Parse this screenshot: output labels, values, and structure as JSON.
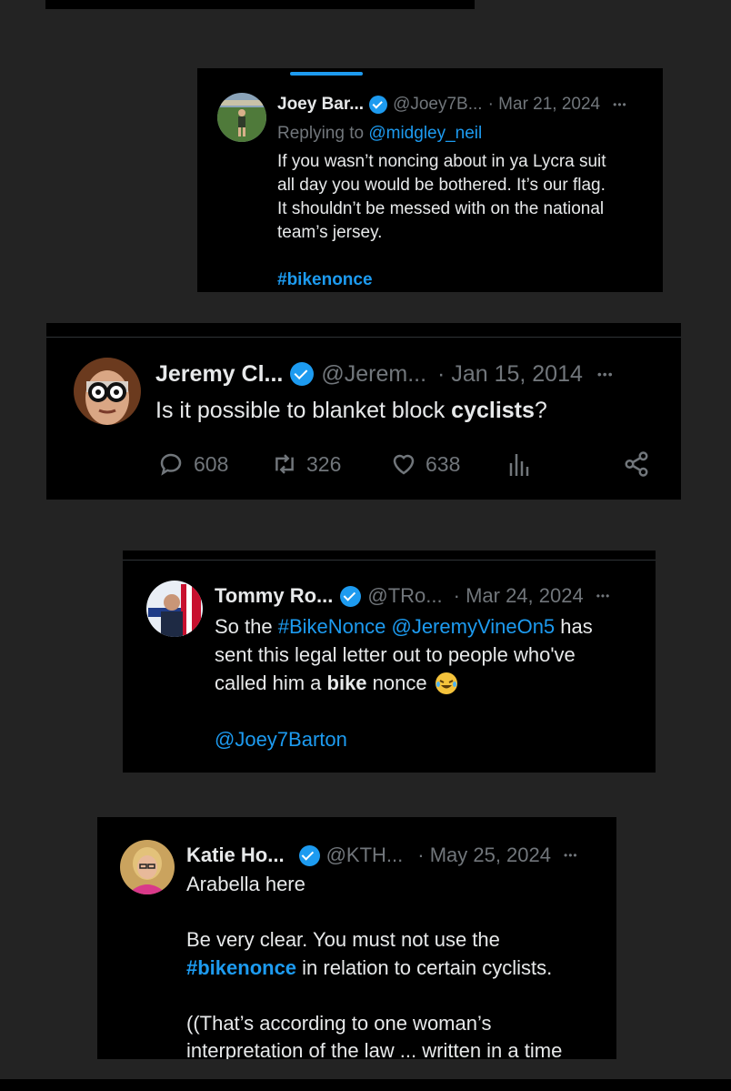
{
  "tweet1": {
    "name": "Joey Bar...",
    "handle": "@Joey7B...",
    "date": "· Mar 21, 2024",
    "more": "•••",
    "replying_prefix": "Replying to ",
    "replying_handle": "@midgley_neil",
    "lines": [
      "If you wasn’t noncing about in ya Lycra suit",
      "all day you would be bothered. It’s our flag.",
      "It shouldn’t be messed with on the national",
      "team’s jersey."
    ],
    "hashtag": "#bikenonce"
  },
  "tweet2": {
    "name": "Jeremy Cl...",
    "handle": "@Jerem...",
    "date": "· Jan 15, 2014",
    "more": "•••",
    "text_prefix": "Is it possible to blanket block ",
    "text_bold": "cyclists",
    "text_suffix": "?",
    "replies": "608",
    "retweets": "326",
    "likes": "638"
  },
  "tweet3": {
    "name": "Tommy Ro...",
    "handle": "@TRo...",
    "date": "· Mar 24, 2024",
    "more": "•••",
    "l1_prefix": "So the ",
    "l1_link1": "#BikeNonce",
    "l1_link2": "@JeremyVineOn5",
    "l1_suffix": " has",
    "l2": "sent this legal letter out to people who've",
    "l3_prefix": "called him a ",
    "l3_bold": "bike",
    "l3_suffix": " nonce",
    "mention": "@Joey7Barton"
  },
  "tweet4": {
    "name": "Katie Ho...",
    "handle": "@KTH...",
    "date": "· May 25, 2024",
    "more": "•••",
    "l1": "Arabella here",
    "l2": "Be very clear. You must not use the",
    "l3_link": "#bikenonce",
    "l3_suffix": " in relation to certain cyclists.",
    "l4": "((That’s according to one woman’s",
    "l5": "interpretation of the law ... written in a time"
  }
}
